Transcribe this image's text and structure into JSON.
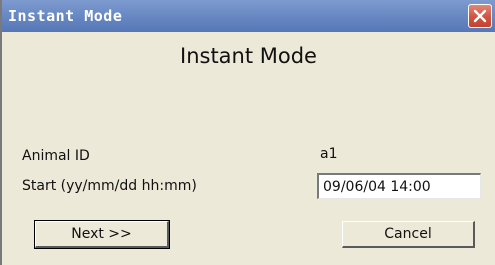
{
  "window": {
    "title": "Instant Mode",
    "close_icon": "close-icon"
  },
  "dialog": {
    "heading": "Instant Mode",
    "animal_id_label": "Animal ID",
    "animal_id_value": "a1",
    "start_label": "Start (yy/mm/dd hh:mm)",
    "start_value": "09/06/04 14:00"
  },
  "buttons": {
    "next_label": "Next >>",
    "cancel_label": "Cancel"
  },
  "colors": {
    "titlebar": "#6a8ac4",
    "close_button": "#d0543f",
    "dialog_background": "#ece9d8"
  }
}
